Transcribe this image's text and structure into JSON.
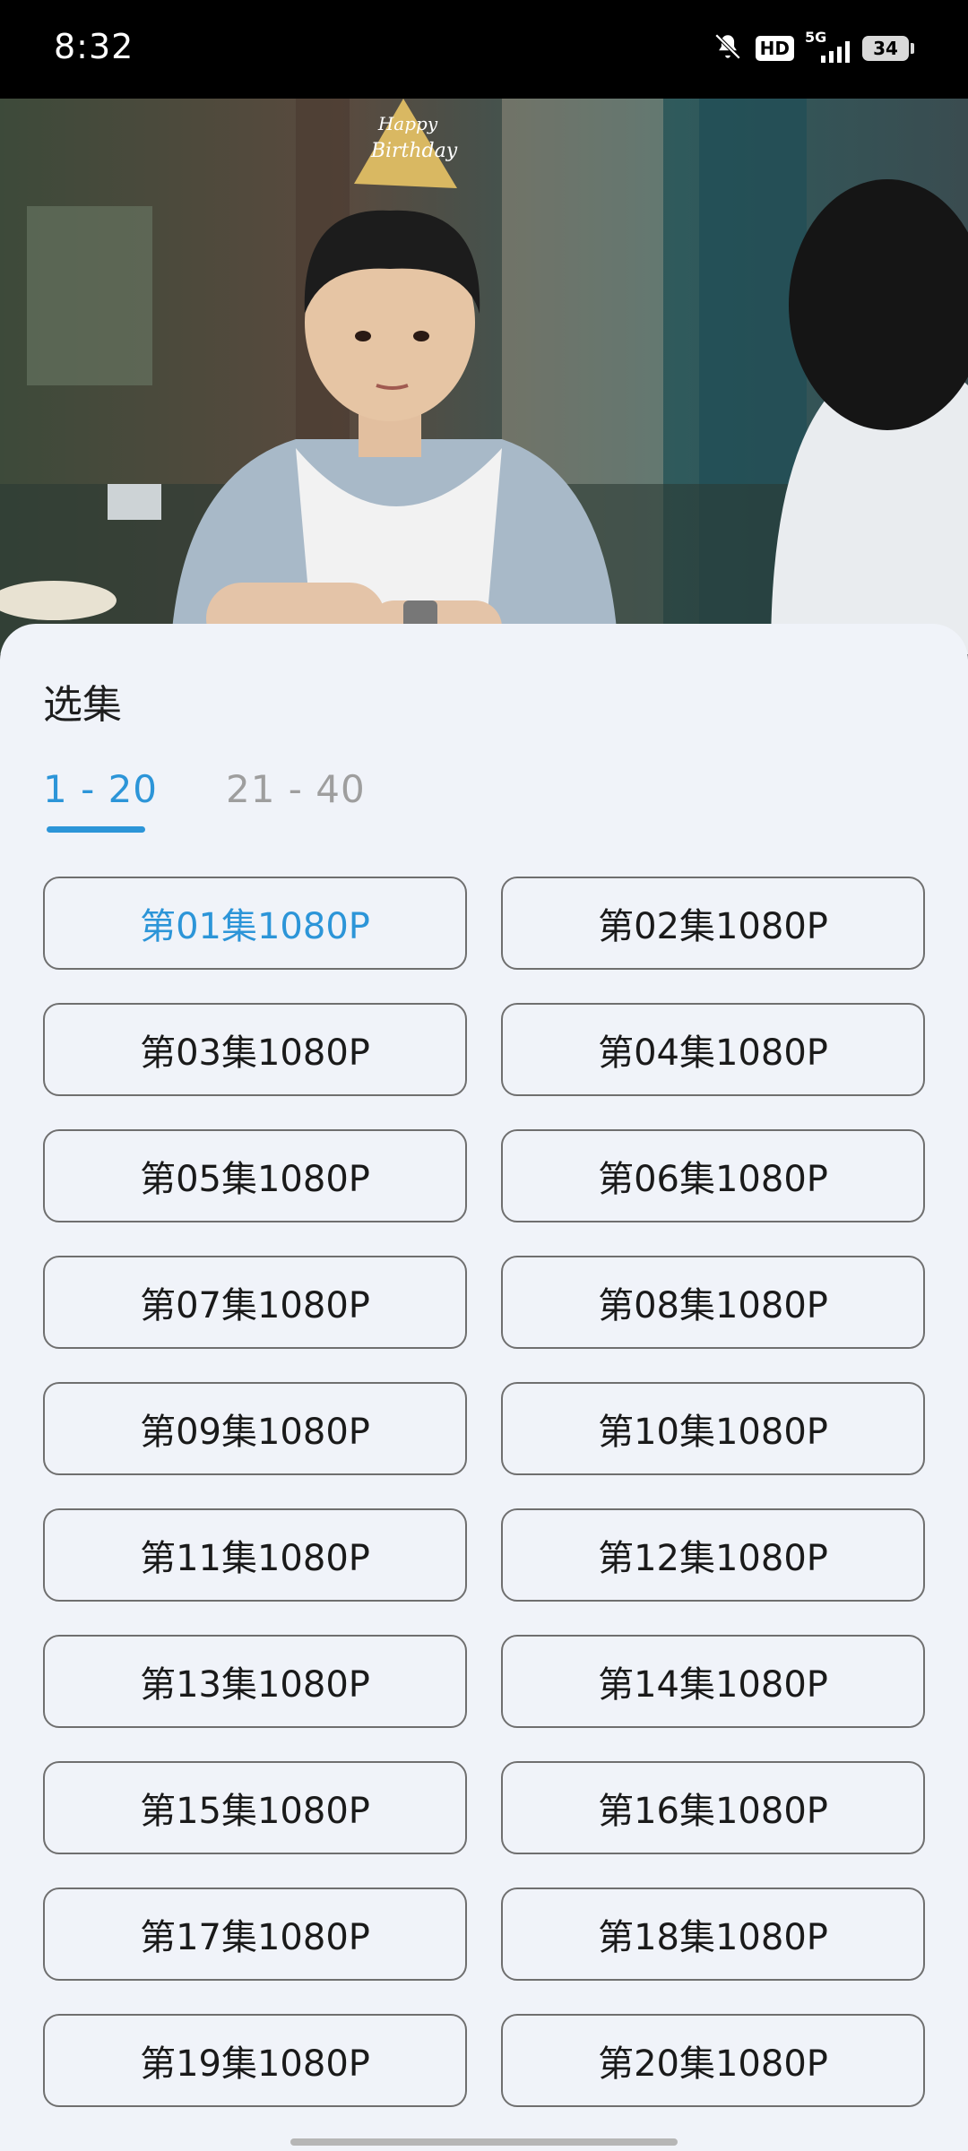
{
  "status_bar": {
    "time": "8:32",
    "hd_label": "HD",
    "network": "5G",
    "battery": "34"
  },
  "video": {
    "hat_text_line1": "Happy",
    "hat_text_line2": "Birthday"
  },
  "sheet": {
    "title": "选集",
    "ranges": [
      {
        "label": "1 - 20",
        "active": true
      },
      {
        "label": "21 - 40",
        "active": false
      }
    ],
    "episodes": [
      {
        "label": "第01集1080P",
        "selected": true
      },
      {
        "label": "第02集1080P"
      },
      {
        "label": "第03集1080P"
      },
      {
        "label": "第04集1080P"
      },
      {
        "label": "第05集1080P"
      },
      {
        "label": "第06集1080P"
      },
      {
        "label": "第07集1080P"
      },
      {
        "label": "第08集1080P"
      },
      {
        "label": "第09集1080P"
      },
      {
        "label": "第10集1080P"
      },
      {
        "label": "第11集1080P"
      },
      {
        "label": "第12集1080P"
      },
      {
        "label": "第13集1080P"
      },
      {
        "label": "第14集1080P"
      },
      {
        "label": "第15集1080P"
      },
      {
        "label": "第16集1080P"
      },
      {
        "label": "第17集1080P"
      },
      {
        "label": "第18集1080P"
      },
      {
        "label": "第19集1080P"
      },
      {
        "label": "第20集1080P"
      }
    ]
  },
  "colors": {
    "accent": "#2c95d8",
    "sheet_bg": "#f0f3f9",
    "button_border": "#6f6f6f"
  }
}
